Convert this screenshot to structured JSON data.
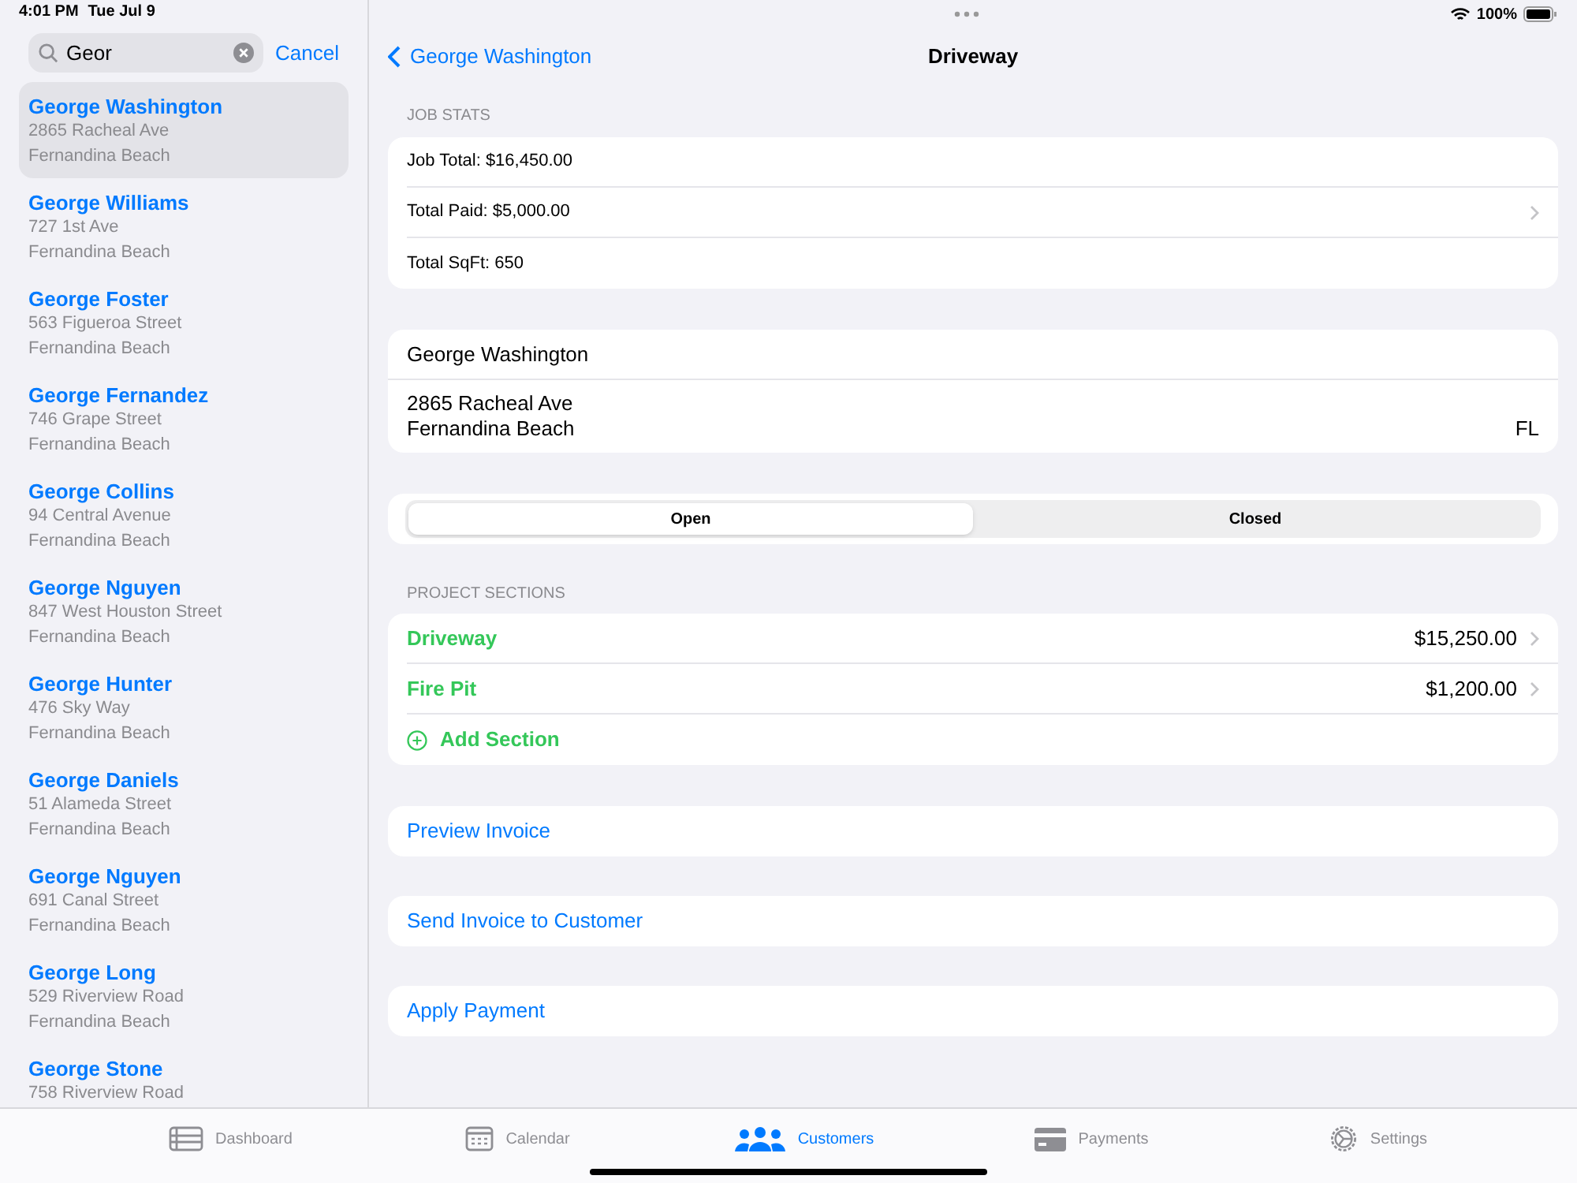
{
  "status_bar": {
    "time": "4:01 PM",
    "date": "Tue Jul 9",
    "battery": "100%"
  },
  "search": {
    "value": "Geor",
    "cancel": "Cancel"
  },
  "customers": [
    {
      "name": "George Washington",
      "address": "2865 Racheal Ave",
      "city": "Fernandina Beach",
      "selected": true
    },
    {
      "name": "George Williams",
      "address": "727 1st Ave",
      "city": "Fernandina Beach",
      "selected": false
    },
    {
      "name": "George Foster",
      "address": "563 Figueroa Street",
      "city": "Fernandina Beach",
      "selected": false
    },
    {
      "name": "George Fernandez",
      "address": "746 Grape Street",
      "city": "Fernandina Beach",
      "selected": false
    },
    {
      "name": "George Collins",
      "address": "94 Central Avenue",
      "city": "Fernandina Beach",
      "selected": false
    },
    {
      "name": "George Nguyen",
      "address": "847 West Houston Street",
      "city": "Fernandina Beach",
      "selected": false
    },
    {
      "name": "George Hunter",
      "address": "476 Sky Way",
      "city": "Fernandina Beach",
      "selected": false
    },
    {
      "name": "George Daniels",
      "address": "51 Alameda Street",
      "city": "Fernandina Beach",
      "selected": false
    },
    {
      "name": "George Nguyen",
      "address": "691 Canal Street",
      "city": "Fernandina Beach",
      "selected": false
    },
    {
      "name": "George Long",
      "address": "529 Riverview Road",
      "city": "Fernandina Beach",
      "selected": false
    },
    {
      "name": "George Stone",
      "address": "758 Riverview Road",
      "selected": false
    }
  ],
  "nav": {
    "back": "George Washington",
    "title": "Driveway"
  },
  "job_stats": {
    "header": "JOB STATS",
    "rows": [
      {
        "label": "Job Total: $16,450.00",
        "chevron": false
      },
      {
        "label": "Total Paid: $5,000.00",
        "chevron": true
      },
      {
        "label": "Total SqFt: 650",
        "chevron": false
      }
    ]
  },
  "customer_card": {
    "name": "George Washington",
    "address": "2865 Racheal Ave",
    "city": "Fernandina Beach",
    "state": "FL"
  },
  "status_segments": [
    {
      "label": "Open",
      "selected": true
    },
    {
      "label": "Closed",
      "selected": false
    }
  ],
  "project_sections": {
    "header": "PROJECT SECTIONS",
    "items": [
      {
        "name": "Driveway",
        "amount": "$15,250.00"
      },
      {
        "name": "Fire Pit",
        "amount": "$1,200.00"
      }
    ],
    "add": "Add Section"
  },
  "actions": [
    "Preview Invoice",
    "Send Invoice to Customer",
    "Apply Payment"
  ],
  "tabs": [
    {
      "label": "Dashboard",
      "kind": "dashboard",
      "selected": false
    },
    {
      "label": "Calendar",
      "kind": "calendar",
      "selected": false
    },
    {
      "label": "Customers",
      "kind": "customers",
      "selected": true
    },
    {
      "label": "Payments",
      "kind": "payments",
      "selected": false
    },
    {
      "label": "Settings",
      "kind": "settings",
      "selected": false
    }
  ]
}
